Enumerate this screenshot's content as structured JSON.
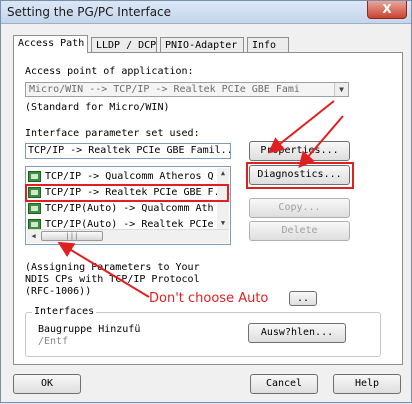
{
  "window": {
    "title": "Setting the PG/PC Interface",
    "close_label": "X"
  },
  "tabs": [
    {
      "label": "Access Path",
      "active": true
    },
    {
      "label": "LLDP / DCP",
      "active": false
    },
    {
      "label": "PNIO-Adapter",
      "active": false
    },
    {
      "label": "Info",
      "active": false
    }
  ],
  "access_point": {
    "label": "Access point of application:",
    "value": "Micro/WIN          --> TCP/IP -> Realtek PCIe GBE Fami",
    "note": "(Standard for Micro/WIN)"
  },
  "interface_param": {
    "label": "Interface parameter set used:",
    "value": "TCP/IP -> Realtek PCIe GBE Famil..."
  },
  "interface_list": [
    {
      "label": "TCP/IP -> Qualcomm Atheros Q"
    },
    {
      "label": "TCP/IP -> Realtek PCIe GBE F..."
    },
    {
      "label": "TCP/IP(Auto) -> Qualcomm Ath"
    },
    {
      "label": "TCP/IP(Auto) -> Realtek PCIe"
    }
  ],
  "buttons": {
    "properties": "Properties...",
    "diagnostics": "Diagnostics...",
    "copy": "Copy...",
    "delete": "Delete",
    "select": "..",
    "add_remove": "Ausw?hlen...",
    "ok": "OK",
    "cancel": "Cancel",
    "help": "Help"
  },
  "description": [
    "(Assigning Parameters to Your",
    "NDIS CPs with TCP/IP Protocol",
    "(RFC-1006))"
  ],
  "interfaces_group": {
    "title": "Interfaces",
    "item_line1": "Baugruppe Hinzufü",
    "item_line2": "        /Entf"
  },
  "annotation": {
    "text": "Don't choose Auto",
    "color": "#e02020"
  },
  "colors": {
    "accent_red": "#e02020",
    "panel_bg": "#ffffff",
    "window_bg": "#f0f0f0"
  }
}
